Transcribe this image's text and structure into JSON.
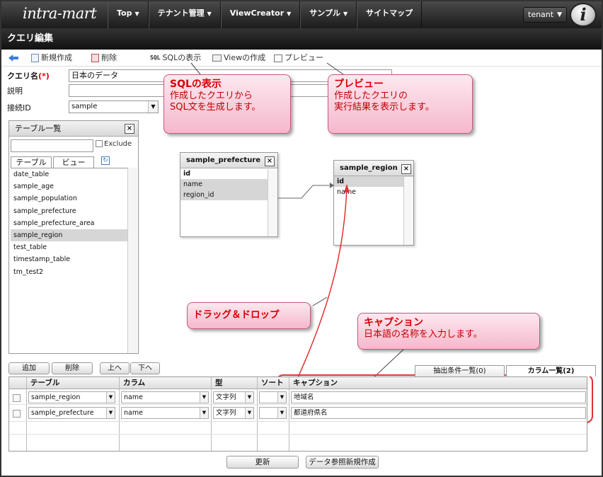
{
  "header": {
    "logo": "intra-mart",
    "nav": [
      {
        "label": "Top"
      },
      {
        "label": "テナント管理"
      },
      {
        "label": "ViewCreator"
      },
      {
        "label": "サンプル"
      },
      {
        "label": "サイトマップ"
      }
    ],
    "tenant": "tenant",
    "info_mark": "i"
  },
  "page": {
    "title": "クエリ編集"
  },
  "toolbar": {
    "new_label": "新規作成",
    "delete_label": "削除",
    "sql_prefix": "SQL",
    "sql_label": "SQLの表示",
    "view_label": "Viewの作成",
    "preview_label": "プレビュー"
  },
  "form": {
    "query_name_label": "クエリ名",
    "required_mark": "(*)",
    "query_name_value": "日本のデータ",
    "description_label": "説明",
    "description_value": "",
    "connection_label": "接続ID",
    "connection_value": "sample"
  },
  "table_panel": {
    "title": "テーブル一覧",
    "exclude_label": "Exclude",
    "tab_table": "テーブル",
    "tab_view": "ビュー",
    "items": [
      "date_table",
      "sample_age",
      "sample_population",
      "sample_prefecture",
      "sample_prefecture_area",
      "sample_region",
      "test_table",
      "timestamp_table",
      "tm_test2"
    ],
    "selected_index": 5
  },
  "canvas": {
    "table1": {
      "name": "sample_prefecture",
      "columns": [
        "id",
        "name",
        "region_id"
      ]
    },
    "table2": {
      "name": "sample_region",
      "columns": [
        "id",
        "name"
      ]
    }
  },
  "callouts": {
    "sql": {
      "title": "SQLの表示",
      "line1": "作成したクエリから",
      "line2": "SQL文を生成します。"
    },
    "preview": {
      "title": "プレビュー",
      "line1": "作成したクエリの",
      "line2": "実行結果を表示します。"
    },
    "drag": {
      "title": "ドラッグ＆ドロップ"
    },
    "caption": {
      "title": "キャプション",
      "line1": "日本語の名称を入力します。"
    }
  },
  "grid": {
    "buttons": {
      "add": "追加",
      "delete": "削除",
      "up": "上へ",
      "down": "下へ"
    },
    "tabs": {
      "conditions": "抽出条件一覧(0)",
      "columns": "カラム一覧(2)"
    },
    "headers": {
      "table": "テーブル",
      "column": "カラム",
      "type": "型",
      "sort": "ソート",
      "caption": "キャプション"
    },
    "rows": [
      {
        "table": "sample_region",
        "column": "name",
        "type": "文字列",
        "sort": "",
        "caption": "地域名"
      },
      {
        "table": "sample_prefecture",
        "column": "name",
        "type": "文字列",
        "sort": "",
        "caption": "都道府県名"
      }
    ]
  },
  "footer": {
    "update": "更新",
    "data_ref": "データ参照新規作成"
  },
  "colors": {
    "accent_red": "#e03030",
    "callout_pink": "#f5b8cc",
    "header_dark": "#1b1b1b"
  }
}
